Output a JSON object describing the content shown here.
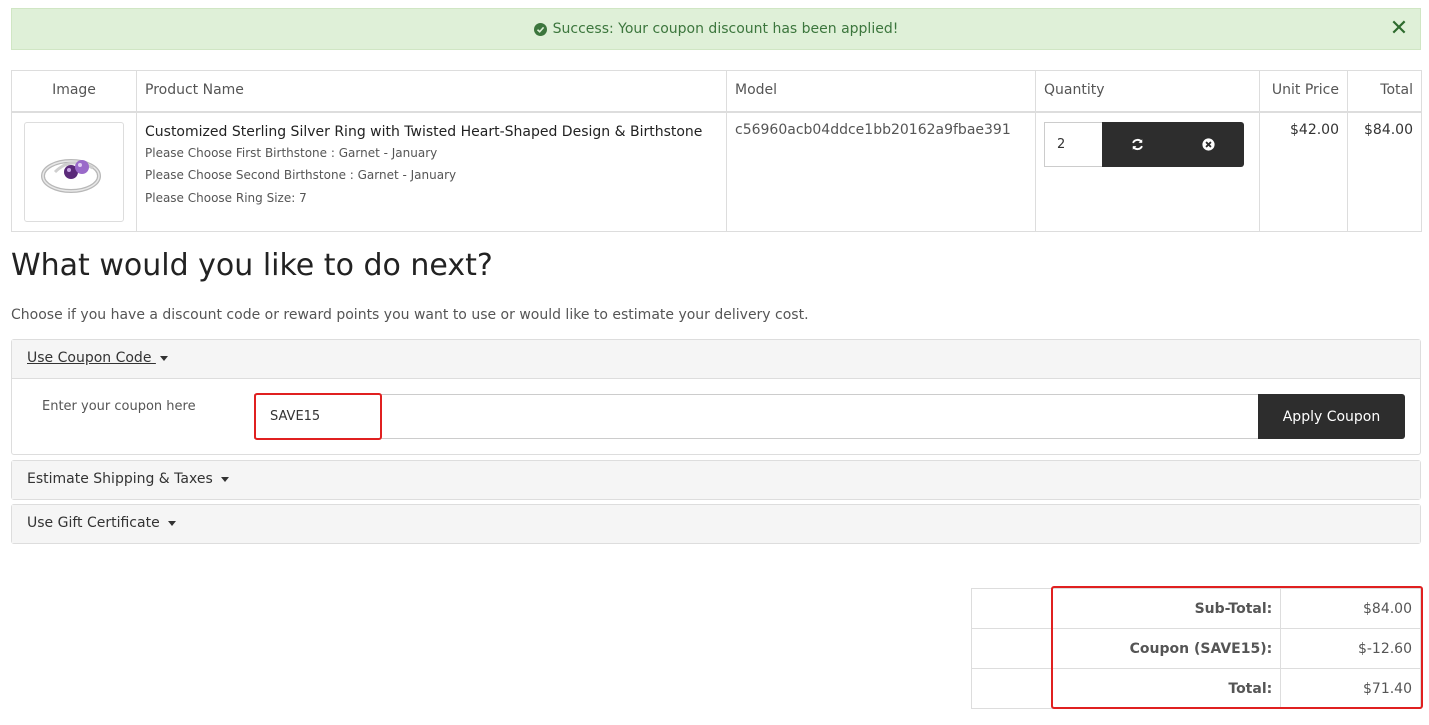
{
  "alert": {
    "message": "Success: Your coupon discount has been applied!",
    "icon": "check-circle-icon",
    "close_glyph": "✕"
  },
  "cart": {
    "headers": {
      "image": "Image",
      "product_name": "Product Name",
      "model": "Model",
      "quantity": "Quantity",
      "unit_price": "Unit Price",
      "total": "Total"
    },
    "item": {
      "name": "Customized Sterling Silver Ring with Twisted Heart-Shaped Design & Birthstone",
      "options": [
        "Please Choose First Birthstone : Garnet - January",
        "Please Choose Second Birthstone : Garnet - January",
        "Please Choose Ring Size: 7"
      ],
      "model": "c56960acb04ddce1bb20162a9fbae391",
      "quantity": "2",
      "unit_price": "$42.00",
      "total": "$84.00"
    }
  },
  "next": {
    "title": "What would you like to do next?",
    "lead": "Choose if you have a discount code or reward points you want to use or would like to estimate your delivery cost."
  },
  "coupon": {
    "heading": "Use Coupon Code ",
    "label": "Enter your coupon here",
    "value": "SAVE15",
    "button": "Apply Coupon"
  },
  "shipping": {
    "heading": "Estimate Shipping & Taxes "
  },
  "gift": {
    "heading": "Use Gift Certificate "
  },
  "totals": [
    {
      "label": "Sub-Total:",
      "value": "$84.00"
    },
    {
      "label": "Coupon (SAVE15):",
      "value": "$-12.60"
    },
    {
      "label": "Total:",
      "value": "$71.40"
    }
  ],
  "colors": {
    "success_bg": "#dff0d8",
    "success_text": "#3c763d",
    "dark_button": "#2d2d2d",
    "highlight": "#e02020"
  }
}
